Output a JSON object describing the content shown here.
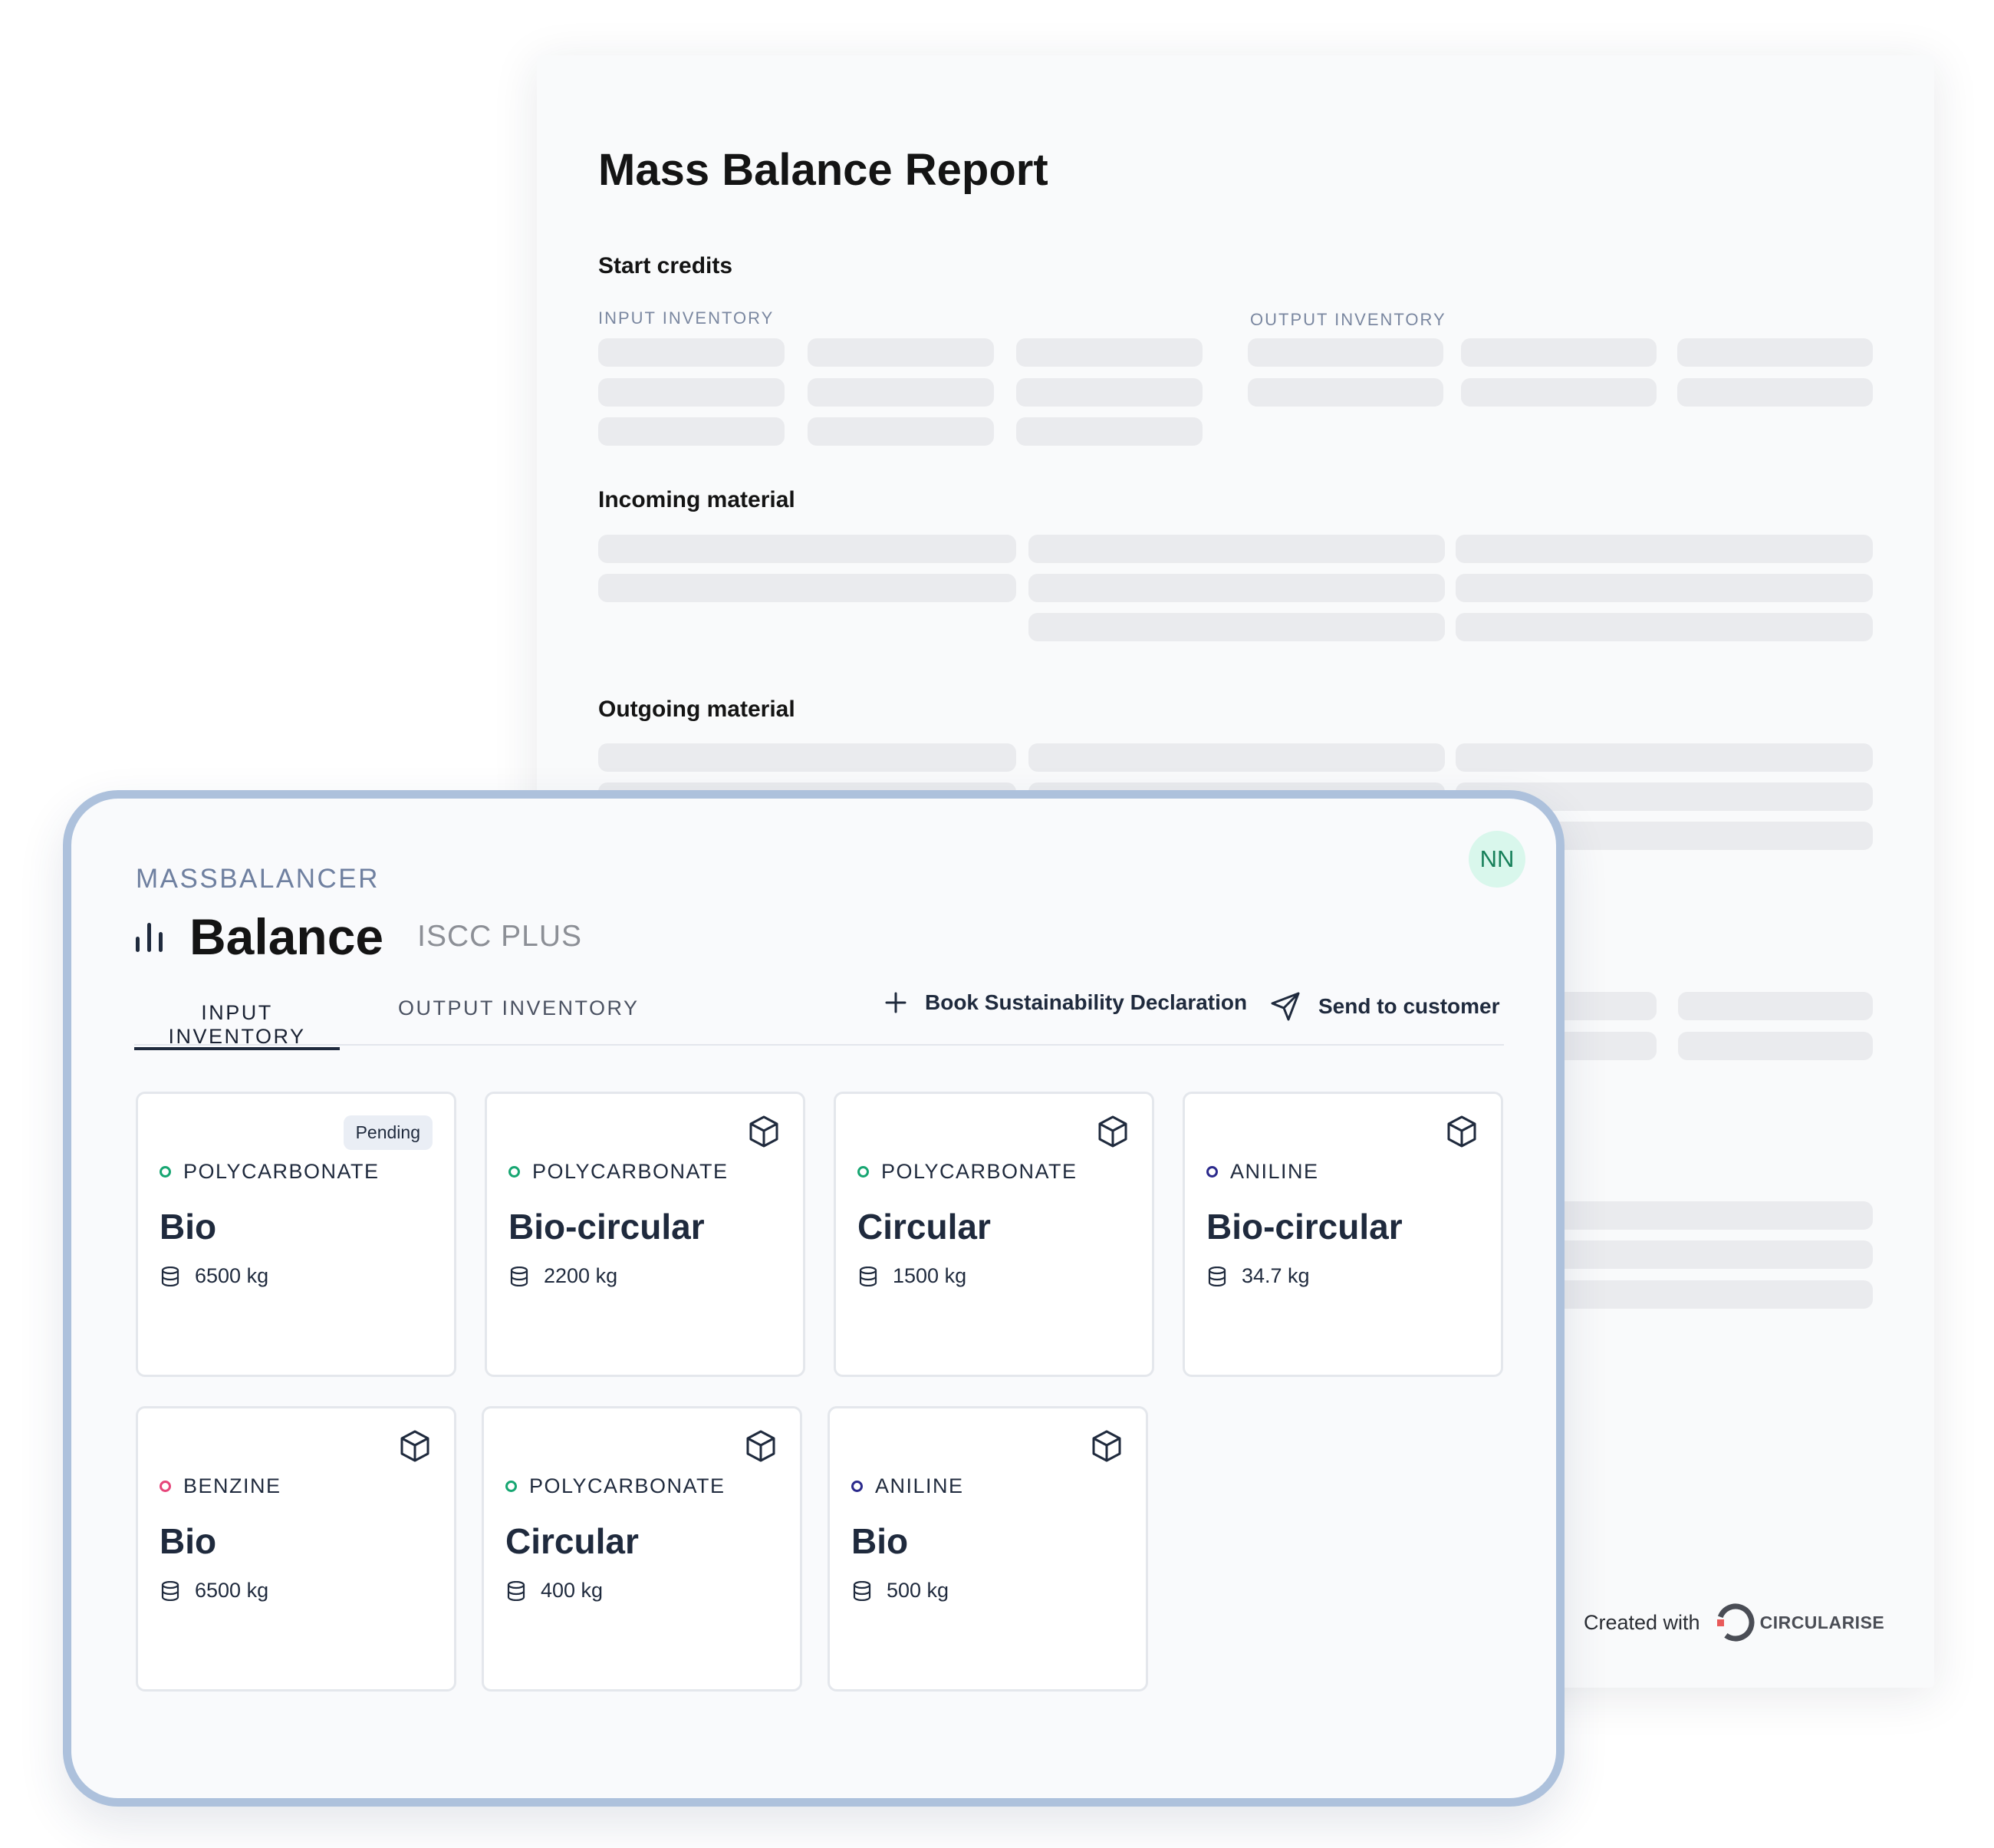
{
  "report": {
    "title": "Mass Balance Report",
    "sections": {
      "start_credits": "Start credits",
      "incoming": "Incoming material",
      "outgoing": "Outgoing material"
    },
    "input_label": "INPUT INVENTORY",
    "output_label": "OUTPUT INVENTORY",
    "footer": {
      "created_with": "Created with",
      "brand": "CIRCULARISE"
    }
  },
  "app": {
    "label": "MASSBALANCER",
    "title": "Balance",
    "subtitle": "ISCC PLUS",
    "avatar": "NN",
    "tabs": [
      {
        "label": "INPUT INVENTORY",
        "active": true
      },
      {
        "label": "OUTPUT INVENTORY",
        "active": false
      }
    ],
    "actions": {
      "book": "Book Sustainability Declaration",
      "send": "Send to customer"
    },
    "colors": {
      "green": "#17a672",
      "pink": "#e6457a",
      "navy": "#2b2a8c",
      "frame": "#adc1dc"
    },
    "cards": [
      {
        "material": "POLYCARBONATE",
        "type": "Bio",
        "qty": "6500 kg",
        "badge": "Pending",
        "dot": "green"
      },
      {
        "material": "POLYCARBONATE",
        "type": "Bio-circular",
        "qty": "2200 kg",
        "dot": "green"
      },
      {
        "material": "POLYCARBONATE",
        "type": "Circular",
        "qty": "1500 kg",
        "dot": "green"
      },
      {
        "material": "ANILINE",
        "type": "Bio-circular",
        "qty": "34.7 kg",
        "dot": "navy"
      },
      {
        "material": "BENZINE",
        "type": "Bio",
        "qty": "6500 kg",
        "dot": "pink"
      },
      {
        "material": "POLYCARBONATE",
        "type": "Circular",
        "qty": "400 kg",
        "dot": "green"
      },
      {
        "material": "ANILINE",
        "type": "Bio",
        "qty": "500 kg",
        "dot": "navy"
      }
    ]
  }
}
